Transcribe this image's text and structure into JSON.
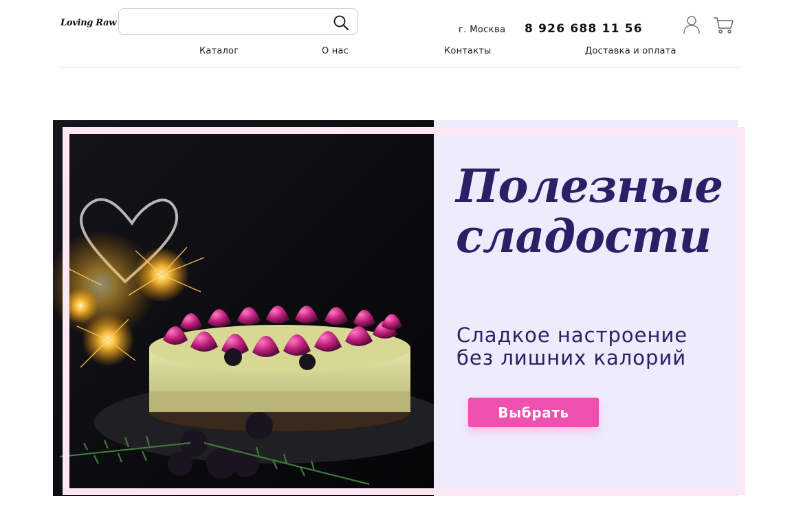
{
  "header": {
    "logo_text": "Loving Raw",
    "search": {
      "value": "",
      "placeholder": ""
    },
    "city": "г. Москва",
    "phone": "8 926 688 11 56",
    "icons": {
      "search": "search-icon",
      "account": "user-icon",
      "cart": "cart-icon"
    }
  },
  "nav": {
    "items": [
      {
        "label": "Каталог"
      },
      {
        "label": "О нас"
      },
      {
        "label": "Контакты"
      },
      {
        "label": "Доставка и оплата"
      }
    ]
  },
  "hero": {
    "title_line1": "Полезные",
    "title_line2": "сладости",
    "subtitle_line1": "Сладкое настроение",
    "subtitle_line2": "без лишних калорий",
    "cta_label": "Выбрать",
    "colors": {
      "title": "#2a2066",
      "panel": "#eeebfc",
      "frame": "#fbe8f3",
      "cta": "#ef4fae"
    }
  }
}
